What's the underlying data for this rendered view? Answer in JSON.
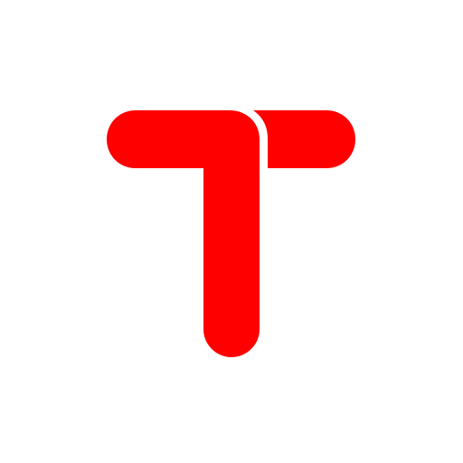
{
  "logo": {
    "icon": "t-letter-logo-icon",
    "letter": "T",
    "fill_color": "#ff0000",
    "background_color": "#ffffff"
  }
}
